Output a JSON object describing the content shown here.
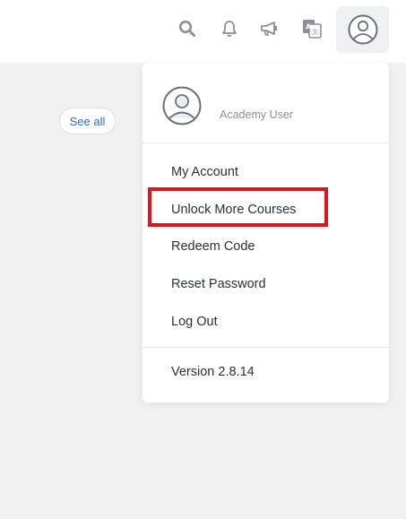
{
  "header": {
    "icons": [
      "search-icon",
      "bell-icon",
      "megaphone-icon",
      "translate-icon",
      "user-avatar-icon"
    ]
  },
  "content": {
    "see_all_label": "See all"
  },
  "user_menu": {
    "role": "Academy User",
    "items": [
      {
        "label": "My Account"
      },
      {
        "label": "Unlock More Courses"
      },
      {
        "label": "Redeem Code"
      },
      {
        "label": "Reset Password"
      },
      {
        "label": "Log Out"
      }
    ],
    "version": "Version 2.8.14"
  },
  "colors": {
    "accent": "#1f6fd1",
    "highlight": "#e0141e",
    "icon": "#8a8f99"
  }
}
